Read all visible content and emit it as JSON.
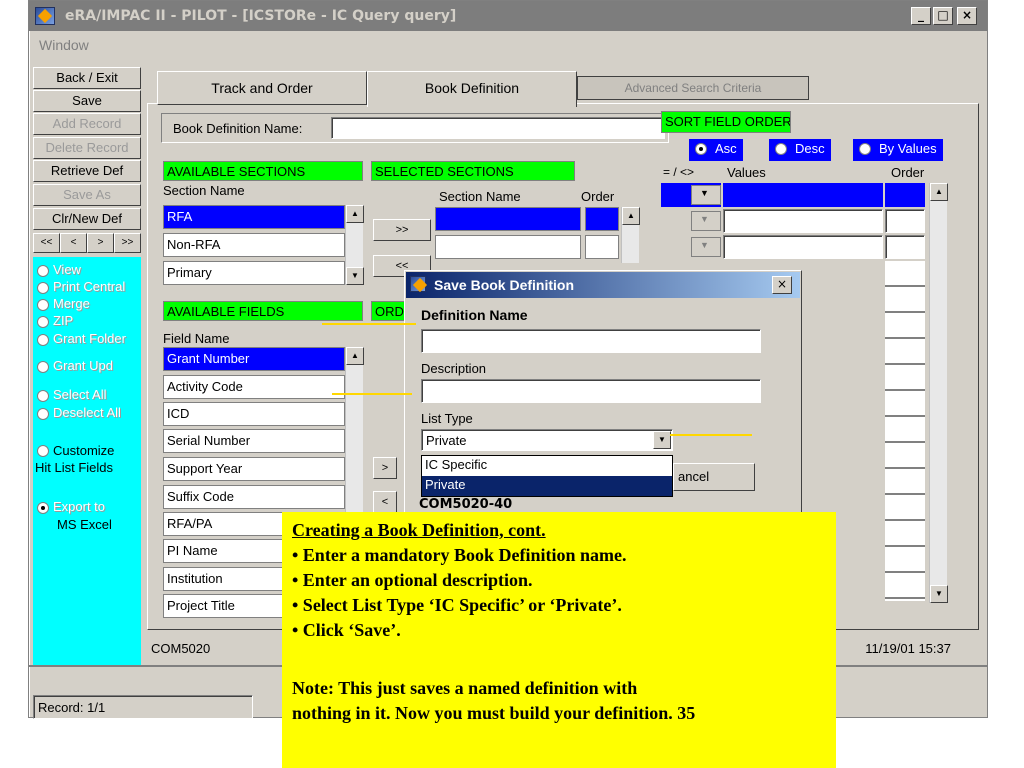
{
  "window": {
    "title": "eRA/IMPAC II - PILOT - [ICSTORe - IC Query query]",
    "menu_window": "Window",
    "minimize": "_",
    "maximize": "□",
    "close": "×"
  },
  "left_buttons": {
    "back_exit": "Back / Exit",
    "save": "Save",
    "add_record": "Add Record",
    "delete_record": "Delete Record",
    "retrieve_def": "Retrieve Def",
    "save_as": "Save As",
    "clr_new_def": "Clr/New Def",
    "nav_first": "<<",
    "nav_prev": "<",
    "nav_next": ">",
    "nav_last": ">>"
  },
  "left_options": {
    "view": "View",
    "print_central": "Print Central",
    "merge": "Merge",
    "zip": "ZIP",
    "grant_folder": "Grant Folder",
    "grant_upd": "Grant Upd",
    "select_all": "Select All",
    "deselect_all": "Deselect All",
    "customize_1": "Customize",
    "customize_2": "Hit List Fields",
    "export_1": "Export to",
    "export_2": "MS Excel"
  },
  "tabs": {
    "track_and_order": "Track and Order",
    "book_definition": "Book Definition",
    "advanced_search": "Advanced Search Criteria"
  },
  "book_definition_name_label": "Book Definition Name:",
  "available_sections": {
    "header": "AVAILABLE SECTIONS",
    "column": "Section Name",
    "items": [
      "RFA",
      "Non-RFA",
      "Primary"
    ]
  },
  "selected_sections": {
    "header": "SELECTED SECTIONS",
    "column_name": "Section Name",
    "column_order": "Order",
    "move_right": ">>",
    "move_left": "<<"
  },
  "available_fields": {
    "header": "AVAILABLE FIELDS",
    "column": "Field Name",
    "items": [
      "Grant Number",
      "Activity Code",
      "ICD",
      "Serial Number",
      "Support Year",
      "Suffix Code",
      "RFA/PA",
      "PI Name",
      "Institution",
      "Project Title"
    ]
  },
  "ordered_fields_header": "ORD",
  "field_move_right": ">",
  "field_move_left": "<",
  "sort_field_order": {
    "header": "SORT FIELD ORDER",
    "asc": "Asc",
    "desc": "Desc",
    "by_values": "By Values",
    "col_op": "= / <>",
    "col_values": "Values",
    "col_order": "Order"
  },
  "dialog": {
    "title": "Save Book Definition",
    "close": "×",
    "definition_name_label": "Definition Name",
    "description_label": "Description",
    "list_type_label": "List Type",
    "list_type_value": "Private",
    "options": [
      "IC Specific",
      "Private"
    ],
    "cancel_partial": "ancel",
    "code": "COM5020-40"
  },
  "status": {
    "form_code": "COM5020",
    "timestamp": "11/19/01 15:37",
    "record": "Record: 1/1"
  },
  "note": {
    "title": "Creating a Book Definition, cont.",
    "bullets": [
      "• Enter a mandatory Book Definition name.",
      "• Enter an optional description.",
      "• Select List Type ‘IC Specific’ or ‘Private’.",
      "• Click ‘Save’."
    ],
    "note_line1": "Note: This just saves a named definition with",
    "note_line2": "nothing in it. Now you must build your definition. 35"
  },
  "colors": {
    "accent_green": "#00ff00",
    "accent_blue": "#0000ff",
    "panel_cyan": "#00ffff",
    "note_yellow": "#ffff00"
  }
}
